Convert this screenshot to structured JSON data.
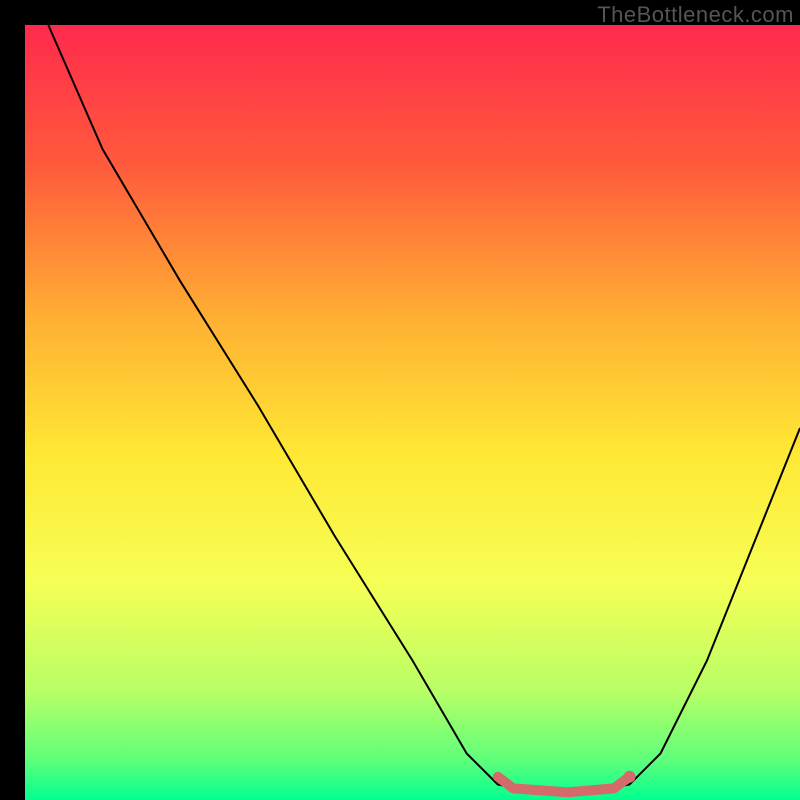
{
  "watermark": "TheBottleneck.com",
  "chart_data": {
    "type": "line",
    "title": "",
    "xlabel": "",
    "ylabel": "",
    "xlim": [
      0,
      100
    ],
    "ylim": [
      0,
      100
    ],
    "gradient_stops": [
      {
        "offset": 0,
        "color": "#ff2a4d"
      },
      {
        "offset": 18,
        "color": "#ff5a3c"
      },
      {
        "offset": 38,
        "color": "#ffb033"
      },
      {
        "offset": 55,
        "color": "#ffe734"
      },
      {
        "offset": 72,
        "color": "#f6ff55"
      },
      {
        "offset": 86,
        "color": "#b7ff66"
      },
      {
        "offset": 95,
        "color": "#5dff7a"
      },
      {
        "offset": 100,
        "color": "#00ff90"
      }
    ],
    "series": [
      {
        "name": "bottleneck-curve",
        "stroke": "#000000",
        "stroke_width": 2,
        "points": [
          {
            "x": 3,
            "y": 100
          },
          {
            "x": 10,
            "y": 84
          },
          {
            "x": 20,
            "y": 67
          },
          {
            "x": 30,
            "y": 51
          },
          {
            "x": 40,
            "y": 34
          },
          {
            "x": 50,
            "y": 18
          },
          {
            "x": 57,
            "y": 6
          },
          {
            "x": 61,
            "y": 2
          },
          {
            "x": 66,
            "y": 1
          },
          {
            "x": 73,
            "y": 1
          },
          {
            "x": 78,
            "y": 2
          },
          {
            "x": 82,
            "y": 6
          },
          {
            "x": 88,
            "y": 18
          },
          {
            "x": 94,
            "y": 33
          },
          {
            "x": 100,
            "y": 48
          }
        ]
      },
      {
        "name": "optimal-range-highlight",
        "stroke": "#d46a6a",
        "stroke_width": 10,
        "line_cap": "round",
        "points": [
          {
            "x": 61,
            "y": 3
          },
          {
            "x": 63,
            "y": 1.5
          },
          {
            "x": 70,
            "y": 1
          },
          {
            "x": 76,
            "y": 1.5
          },
          {
            "x": 78,
            "y": 3
          }
        ]
      }
    ],
    "markers": [
      {
        "name": "optimal-end-dot",
        "x": 78,
        "y": 3,
        "r": 6,
        "color": "#d46a6a"
      }
    ]
  }
}
